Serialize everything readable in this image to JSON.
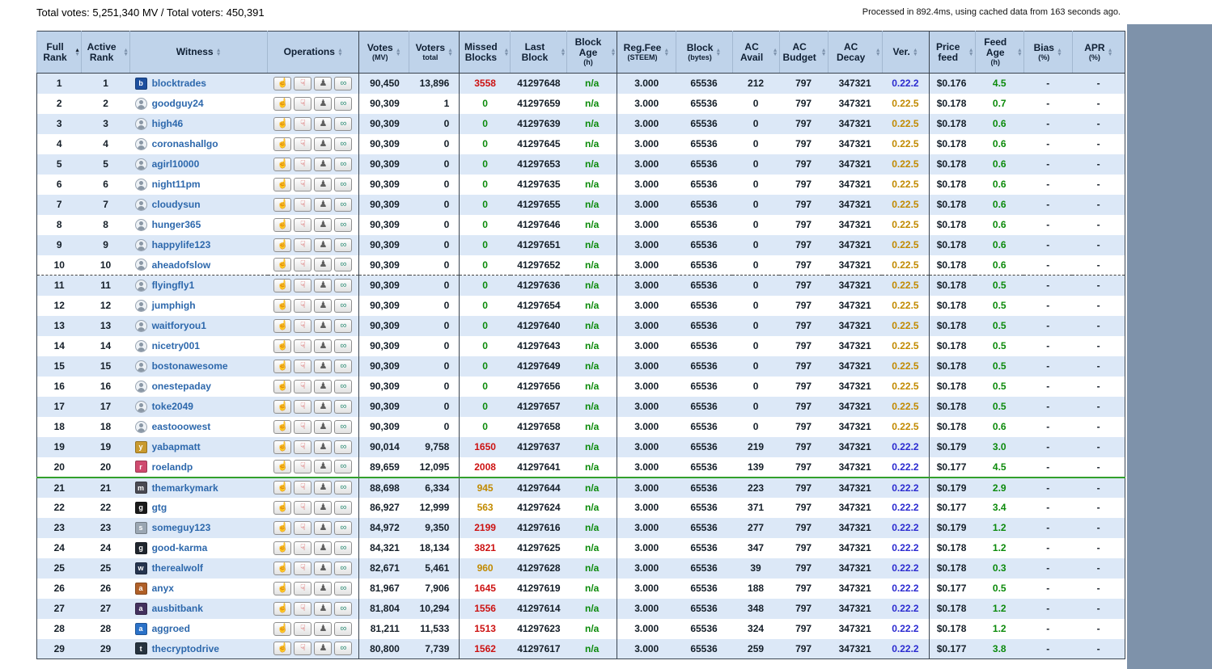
{
  "page": {
    "totals": "Total votes: 5,251,340 MV / Total voters: 450,391",
    "processed": "Processed in 892.4ms, using cached data from 163 seconds ago."
  },
  "colors": {
    "page_background": "#7e92aa",
    "header_background": "#bfd3ea",
    "alt_row": "#dce8f7",
    "ok_green": "#0b8a0b",
    "warn_gold": "#c18a00",
    "bad_red": "#cc1111",
    "version_blue": "#2a2ad0",
    "top20_divider_green": "#33a02c"
  },
  "ops": {
    "upvote_glyph": "☝",
    "downvote_glyph": "☟",
    "proxy_glyph": "♟",
    "link_glyph": "∞"
  },
  "table": {
    "headers": [
      {
        "label": "Full Rank",
        "sub": "",
        "sc": "sort asc",
        "thcls": ""
      },
      {
        "label": "Active Rank",
        "sub": "",
        "sc": "sort",
        "thcls": ""
      },
      {
        "label": "Witness",
        "sub": "",
        "sc": "sort",
        "thcls": ""
      },
      {
        "label": "Operations",
        "sub": "",
        "sc": "sort",
        "thcls": ""
      },
      {
        "label": "Votes",
        "sub": "(MV)",
        "sc": "sort",
        "thcls": "gs"
      },
      {
        "label": "Voters",
        "sub": "total",
        "sc": "sort",
        "thcls": ""
      },
      {
        "label": "Missed Blocks",
        "sub": "",
        "sc": "sort",
        "thcls": "gs"
      },
      {
        "label": "Last Block",
        "sub": "",
        "sc": "sort",
        "thcls": ""
      },
      {
        "label": "Block Age",
        "sub": "(h)",
        "sc": "sort",
        "thcls": ""
      },
      {
        "label": "Reg.Fee",
        "sub": "(STEEM)",
        "sc": "sort",
        "thcls": "gs"
      },
      {
        "label": "Block",
        "sub": "(bytes)",
        "sc": "sort",
        "thcls": ""
      },
      {
        "label": "AC Avail",
        "sub": "",
        "sc": "sort",
        "thcls": ""
      },
      {
        "label": "AC Budget",
        "sub": "",
        "sc": "sort",
        "thcls": ""
      },
      {
        "label": "AC Decay",
        "sub": "",
        "sc": "sort",
        "thcls": ""
      },
      {
        "label": "Ver.",
        "sub": "",
        "sc": "sort",
        "thcls": ""
      },
      {
        "label": "Price feed",
        "sub": "",
        "sc": "sort",
        "thcls": "gs"
      },
      {
        "label": "Feed Age",
        "sub": "(h)",
        "sc": "sort",
        "thcls": ""
      },
      {
        "label": "Bias",
        "sub": "(%)",
        "sc": "sort",
        "thcls": ""
      },
      {
        "label": "APR",
        "sub": "(%)",
        "sc": "sort",
        "thcls": ""
      }
    ],
    "rows": [
      {
        "fr": "1",
        "ar": "1",
        "w": "blocktrades",
        "at": "custom",
        "avs": "background:#1d4f9e",
        "avl": "b",
        "votes": "90,450",
        "voters": "13,896",
        "missed": "3558",
        "mc": "v-red",
        "lb": "41297648",
        "ba": "n/a",
        "fee": "3.000",
        "bsize": "65536",
        "aca": "212",
        "acb": "797",
        "acd": "347321",
        "ver": "0.22.2",
        "vc": "v-blue",
        "price": "$0.176",
        "fage": "4.5",
        "bias": "-",
        "apr": "-",
        "sep": ""
      },
      {
        "fr": "2",
        "ar": "2",
        "w": "goodguy24",
        "at": "generic",
        "avs": "",
        "avl": "",
        "votes": "90,309",
        "voters": "1",
        "missed": "0",
        "mc": "v-green",
        "lb": "41297659",
        "ba": "n/a",
        "fee": "3.000",
        "bsize": "65536",
        "aca": "0",
        "acb": "797",
        "acd": "347321",
        "ver": "0.22.5",
        "vc": "v-gold",
        "price": "$0.178",
        "fage": "0.7",
        "bias": "-",
        "apr": "-",
        "sep": ""
      },
      {
        "fr": "3",
        "ar": "3",
        "w": "high46",
        "at": "generic",
        "avs": "",
        "avl": "",
        "votes": "90,309",
        "voters": "0",
        "missed": "0",
        "mc": "v-green",
        "lb": "41297639",
        "ba": "n/a",
        "fee": "3.000",
        "bsize": "65536",
        "aca": "0",
        "acb": "797",
        "acd": "347321",
        "ver": "0.22.5",
        "vc": "v-gold",
        "price": "$0.178",
        "fage": "0.6",
        "bias": "-",
        "apr": "-",
        "sep": ""
      },
      {
        "fr": "4",
        "ar": "4",
        "w": "coronashallgo",
        "at": "generic",
        "avs": "",
        "avl": "",
        "votes": "90,309",
        "voters": "0",
        "missed": "0",
        "mc": "v-green",
        "lb": "41297645",
        "ba": "n/a",
        "fee": "3.000",
        "bsize": "65536",
        "aca": "0",
        "acb": "797",
        "acd": "347321",
        "ver": "0.22.5",
        "vc": "v-gold",
        "price": "$0.178",
        "fage": "0.6",
        "bias": "-",
        "apr": "-",
        "sep": ""
      },
      {
        "fr": "5",
        "ar": "5",
        "w": "agirl10000",
        "at": "generic",
        "avs": "",
        "avl": "",
        "votes": "90,309",
        "voters": "0",
        "missed": "0",
        "mc": "v-green",
        "lb": "41297653",
        "ba": "n/a",
        "fee": "3.000",
        "bsize": "65536",
        "aca": "0",
        "acb": "797",
        "acd": "347321",
        "ver": "0.22.5",
        "vc": "v-gold",
        "price": "$0.178",
        "fage": "0.6",
        "bias": "-",
        "apr": "-",
        "sep": ""
      },
      {
        "fr": "6",
        "ar": "6",
        "w": "night11pm",
        "at": "generic",
        "avs": "",
        "avl": "",
        "votes": "90,309",
        "voters": "0",
        "missed": "0",
        "mc": "v-green",
        "lb": "41297635",
        "ba": "n/a",
        "fee": "3.000",
        "bsize": "65536",
        "aca": "0",
        "acb": "797",
        "acd": "347321",
        "ver": "0.22.5",
        "vc": "v-gold",
        "price": "$0.178",
        "fage": "0.6",
        "bias": "-",
        "apr": "-",
        "sep": ""
      },
      {
        "fr": "7",
        "ar": "7",
        "w": "cloudysun",
        "at": "generic",
        "avs": "",
        "avl": "",
        "votes": "90,309",
        "voters": "0",
        "missed": "0",
        "mc": "v-green",
        "lb": "41297655",
        "ba": "n/a",
        "fee": "3.000",
        "bsize": "65536",
        "aca": "0",
        "acb": "797",
        "acd": "347321",
        "ver": "0.22.5",
        "vc": "v-gold",
        "price": "$0.178",
        "fage": "0.6",
        "bias": "-",
        "apr": "-",
        "sep": ""
      },
      {
        "fr": "8",
        "ar": "8",
        "w": "hunger365",
        "at": "generic",
        "avs": "",
        "avl": "",
        "votes": "90,309",
        "voters": "0",
        "missed": "0",
        "mc": "v-green",
        "lb": "41297646",
        "ba": "n/a",
        "fee": "3.000",
        "bsize": "65536",
        "aca": "0",
        "acb": "797",
        "acd": "347321",
        "ver": "0.22.5",
        "vc": "v-gold",
        "price": "$0.178",
        "fage": "0.6",
        "bias": "-",
        "apr": "-",
        "sep": ""
      },
      {
        "fr": "9",
        "ar": "9",
        "w": "happylife123",
        "at": "generic",
        "avs": "",
        "avl": "",
        "votes": "90,309",
        "voters": "0",
        "missed": "0",
        "mc": "v-green",
        "lb": "41297651",
        "ba": "n/a",
        "fee": "3.000",
        "bsize": "65536",
        "aca": "0",
        "acb": "797",
        "acd": "347321",
        "ver": "0.22.5",
        "vc": "v-gold",
        "price": "$0.178",
        "fage": "0.6",
        "bias": "-",
        "apr": "-",
        "sep": ""
      },
      {
        "fr": "10",
        "ar": "10",
        "w": "aheadofslow",
        "at": "generic",
        "avs": "",
        "avl": "",
        "votes": "90,309",
        "voters": "0",
        "missed": "0",
        "mc": "v-green",
        "lb": "41297652",
        "ba": "n/a",
        "fee": "3.000",
        "bsize": "65536",
        "aca": "0",
        "acb": "797",
        "acd": "347321",
        "ver": "0.22.5",
        "vc": "v-gold",
        "price": "$0.178",
        "fage": "0.6",
        "bias": "-",
        "apr": "-",
        "sep": "dashed"
      },
      {
        "fr": "11",
        "ar": "11",
        "w": "flyingfly1",
        "at": "generic",
        "avs": "",
        "avl": "",
        "votes": "90,309",
        "voters": "0",
        "missed": "0",
        "mc": "v-green",
        "lb": "41297636",
        "ba": "n/a",
        "fee": "3.000",
        "bsize": "65536",
        "aca": "0",
        "acb": "797",
        "acd": "347321",
        "ver": "0.22.5",
        "vc": "v-gold",
        "price": "$0.178",
        "fage": "0.5",
        "bias": "-",
        "apr": "-",
        "sep": ""
      },
      {
        "fr": "12",
        "ar": "12",
        "w": "jumphigh",
        "at": "generic",
        "avs": "",
        "avl": "",
        "votes": "90,309",
        "voters": "0",
        "missed": "0",
        "mc": "v-green",
        "lb": "41297654",
        "ba": "n/a",
        "fee": "3.000",
        "bsize": "65536",
        "aca": "0",
        "acb": "797",
        "acd": "347321",
        "ver": "0.22.5",
        "vc": "v-gold",
        "price": "$0.178",
        "fage": "0.5",
        "bias": "-",
        "apr": "-",
        "sep": ""
      },
      {
        "fr": "13",
        "ar": "13",
        "w": "waitforyou1",
        "at": "generic",
        "avs": "",
        "avl": "",
        "votes": "90,309",
        "voters": "0",
        "missed": "0",
        "mc": "v-green",
        "lb": "41297640",
        "ba": "n/a",
        "fee": "3.000",
        "bsize": "65536",
        "aca": "0",
        "acb": "797",
        "acd": "347321",
        "ver": "0.22.5",
        "vc": "v-gold",
        "price": "$0.178",
        "fage": "0.5",
        "bias": "-",
        "apr": "-",
        "sep": ""
      },
      {
        "fr": "14",
        "ar": "14",
        "w": "nicetry001",
        "at": "generic",
        "avs": "",
        "avl": "",
        "votes": "90,309",
        "voters": "0",
        "missed": "0",
        "mc": "v-green",
        "lb": "41297643",
        "ba": "n/a",
        "fee": "3.000",
        "bsize": "65536",
        "aca": "0",
        "acb": "797",
        "acd": "347321",
        "ver": "0.22.5",
        "vc": "v-gold",
        "price": "$0.178",
        "fage": "0.5",
        "bias": "-",
        "apr": "-",
        "sep": ""
      },
      {
        "fr": "15",
        "ar": "15",
        "w": "bostonawesome",
        "at": "generic",
        "avs": "",
        "avl": "",
        "votes": "90,309",
        "voters": "0",
        "missed": "0",
        "mc": "v-green",
        "lb": "41297649",
        "ba": "n/a",
        "fee": "3.000",
        "bsize": "65536",
        "aca": "0",
        "acb": "797",
        "acd": "347321",
        "ver": "0.22.5",
        "vc": "v-gold",
        "price": "$0.178",
        "fage": "0.5",
        "bias": "-",
        "apr": "-",
        "sep": ""
      },
      {
        "fr": "16",
        "ar": "16",
        "w": "onestepaday",
        "at": "generic",
        "avs": "",
        "avl": "",
        "votes": "90,309",
        "voters": "0",
        "missed": "0",
        "mc": "v-green",
        "lb": "41297656",
        "ba": "n/a",
        "fee": "3.000",
        "bsize": "65536",
        "aca": "0",
        "acb": "797",
        "acd": "347321",
        "ver": "0.22.5",
        "vc": "v-gold",
        "price": "$0.178",
        "fage": "0.5",
        "bias": "-",
        "apr": "-",
        "sep": ""
      },
      {
        "fr": "17",
        "ar": "17",
        "w": "toke2049",
        "at": "generic",
        "avs": "",
        "avl": "",
        "votes": "90,309",
        "voters": "0",
        "missed": "0",
        "mc": "v-green",
        "lb": "41297657",
        "ba": "n/a",
        "fee": "3.000",
        "bsize": "65536",
        "aca": "0",
        "acb": "797",
        "acd": "347321",
        "ver": "0.22.5",
        "vc": "v-gold",
        "price": "$0.178",
        "fage": "0.5",
        "bias": "-",
        "apr": "-",
        "sep": ""
      },
      {
        "fr": "18",
        "ar": "18",
        "w": "eastooowest",
        "at": "generic",
        "avs": "",
        "avl": "",
        "votes": "90,309",
        "voters": "0",
        "missed": "0",
        "mc": "v-green",
        "lb": "41297658",
        "ba": "n/a",
        "fee": "3.000",
        "bsize": "65536",
        "aca": "0",
        "acb": "797",
        "acd": "347321",
        "ver": "0.22.5",
        "vc": "v-gold",
        "price": "$0.178",
        "fage": "0.6",
        "bias": "-",
        "apr": "-",
        "sep": ""
      },
      {
        "fr": "19",
        "ar": "19",
        "w": "yabapmatt",
        "at": "custom",
        "avs": "background:#c99a2e",
        "avl": "y",
        "votes": "90,014",
        "voters": "9,758",
        "missed": "1650",
        "mc": "v-red",
        "lb": "41297637",
        "ba": "n/a",
        "fee": "3.000",
        "bsize": "65536",
        "aca": "219",
        "acb": "797",
        "acd": "347321",
        "ver": "0.22.2",
        "vc": "v-blue",
        "price": "$0.179",
        "fage": "3.0",
        "bias": "-",
        "apr": "-",
        "sep": ""
      },
      {
        "fr": "20",
        "ar": "20",
        "w": "roelandp",
        "at": "custom",
        "avs": "background:#cf4a6e",
        "avl": "r",
        "votes": "89,659",
        "voters": "12,095",
        "missed": "2008",
        "mc": "v-red",
        "lb": "41297641",
        "ba": "n/a",
        "fee": "3.000",
        "bsize": "65536",
        "aca": "139",
        "acb": "797",
        "acd": "347321",
        "ver": "0.22.2",
        "vc": "v-blue",
        "price": "$0.177",
        "fage": "4.5",
        "bias": "-",
        "apr": "-",
        "sep": "green"
      },
      {
        "fr": "21",
        "ar": "21",
        "w": "themarkymark",
        "at": "custom",
        "avs": "background:#4a4a52",
        "avl": "m",
        "votes": "88,698",
        "voters": "6,334",
        "missed": "945",
        "mc": "v-gold",
        "lb": "41297644",
        "ba": "n/a",
        "fee": "3.000",
        "bsize": "65536",
        "aca": "223",
        "acb": "797",
        "acd": "347321",
        "ver": "0.22.2",
        "vc": "v-blue",
        "price": "$0.179",
        "fage": "2.9",
        "bias": "-",
        "apr": "-",
        "sep": ""
      },
      {
        "fr": "22",
        "ar": "22",
        "w": "gtg",
        "at": "custom",
        "avs": "background:#1a1a1a",
        "avl": "g",
        "votes": "86,927",
        "voters": "12,999",
        "missed": "563",
        "mc": "v-gold",
        "lb": "41297624",
        "ba": "n/a",
        "fee": "3.000",
        "bsize": "65536",
        "aca": "371",
        "acb": "797",
        "acd": "347321",
        "ver": "0.22.2",
        "vc": "v-blue",
        "price": "$0.177",
        "fage": "3.4",
        "bias": "-",
        "apr": "-",
        "sep": ""
      },
      {
        "fr": "23",
        "ar": "23",
        "w": "someguy123",
        "at": "custom",
        "avs": "background:#9aa6b2",
        "avl": "s",
        "votes": "84,972",
        "voters": "9,350",
        "missed": "2199",
        "mc": "v-red",
        "lb": "41297616",
        "ba": "n/a",
        "fee": "3.000",
        "bsize": "65536",
        "aca": "277",
        "acb": "797",
        "acd": "347321",
        "ver": "0.22.2",
        "vc": "v-blue",
        "price": "$0.179",
        "fage": "1.2",
        "bias": "-",
        "apr": "-",
        "sep": ""
      },
      {
        "fr": "24",
        "ar": "24",
        "w": "good-karma",
        "at": "custom",
        "avs": "background:#20262e",
        "avl": "g",
        "votes": "84,321",
        "voters": "18,134",
        "missed": "3821",
        "mc": "v-red",
        "lb": "41297625",
        "ba": "n/a",
        "fee": "3.000",
        "bsize": "65536",
        "aca": "347",
        "acb": "797",
        "acd": "347321",
        "ver": "0.22.2",
        "vc": "v-blue",
        "price": "$0.178",
        "fage": "1.2",
        "bias": "-",
        "apr": "-",
        "sep": ""
      },
      {
        "fr": "25",
        "ar": "25",
        "w": "therealwolf",
        "at": "custom",
        "avs": "background:#26354f",
        "avl": "w",
        "votes": "82,671",
        "voters": "5,461",
        "missed": "960",
        "mc": "v-gold",
        "lb": "41297628",
        "ba": "n/a",
        "fee": "3.000",
        "bsize": "65536",
        "aca": "39",
        "acb": "797",
        "acd": "347321",
        "ver": "0.22.2",
        "vc": "v-blue",
        "price": "$0.178",
        "fage": "0.3",
        "bias": "-",
        "apr": "-",
        "sep": ""
      },
      {
        "fr": "26",
        "ar": "26",
        "w": "anyx",
        "at": "custom",
        "avs": "background:#b06028",
        "avl": "a",
        "votes": "81,967",
        "voters": "7,906",
        "missed": "1645",
        "mc": "v-red",
        "lb": "41297619",
        "ba": "n/a",
        "fee": "3.000",
        "bsize": "65536",
        "aca": "188",
        "acb": "797",
        "acd": "347321",
        "ver": "0.22.2",
        "vc": "v-blue",
        "price": "$0.177",
        "fage": "0.5",
        "bias": "-",
        "apr": "-",
        "sep": ""
      },
      {
        "fr": "27",
        "ar": "27",
        "w": "ausbitbank",
        "at": "custom",
        "avs": "background:#43315e",
        "avl": "a",
        "votes": "81,804",
        "voters": "10,294",
        "missed": "1556",
        "mc": "v-red",
        "lb": "41297614",
        "ba": "n/a",
        "fee": "3.000",
        "bsize": "65536",
        "aca": "348",
        "acb": "797",
        "acd": "347321",
        "ver": "0.22.2",
        "vc": "v-blue",
        "price": "$0.178",
        "fage": "1.2",
        "bias": "-",
        "apr": "-",
        "sep": ""
      },
      {
        "fr": "28",
        "ar": "28",
        "w": "aggroed",
        "at": "custom",
        "avs": "background:#2b72c8",
        "avl": "a",
        "votes": "81,211",
        "voters": "11,533",
        "missed": "1513",
        "mc": "v-red",
        "lb": "41297623",
        "ba": "n/a",
        "fee": "3.000",
        "bsize": "65536",
        "aca": "324",
        "acb": "797",
        "acd": "347321",
        "ver": "0.22.2",
        "vc": "v-blue",
        "price": "$0.178",
        "fage": "1.2",
        "bias": "-",
        "apr": "-",
        "sep": ""
      },
      {
        "fr": "29",
        "ar": "29",
        "w": "thecryptodrive",
        "at": "custom",
        "avs": "background:#27333f",
        "avl": "t",
        "votes": "80,800",
        "voters": "7,739",
        "missed": "1562",
        "mc": "v-red",
        "lb": "41297617",
        "ba": "n/a",
        "fee": "3.000",
        "bsize": "65536",
        "aca": "259",
        "acb": "797",
        "acd": "347321",
        "ver": "0.22.2",
        "vc": "v-blue",
        "price": "$0.177",
        "fage": "3.8",
        "bias": "-",
        "apr": "-",
        "sep": ""
      }
    ]
  }
}
